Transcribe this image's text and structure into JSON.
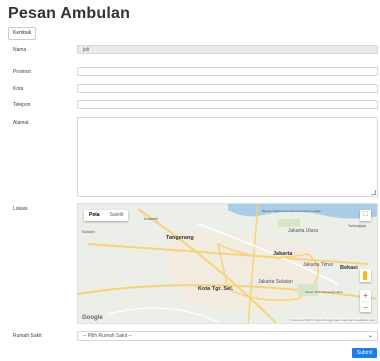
{
  "page": {
    "title": "Pesan Ambulan",
    "back_label": "Kembali"
  },
  "form": {
    "nama": {
      "label": "Nama",
      "value": "joli"
    },
    "provinsi": {
      "label": "Provinsi",
      "value": ""
    },
    "kota": {
      "label": "Kota",
      "value": ""
    },
    "telepon": {
      "label": "Telepon",
      "value": ""
    },
    "alamat": {
      "label": "Alamat",
      "value": ""
    },
    "lokasi": {
      "label": "Lokasi"
    },
    "rumah_sakit": {
      "label": "Rumah Sakit",
      "selected": "-- Pilih Rumah Sakit --"
    },
    "submit_label": "Submit"
  },
  "map": {
    "tabs": [
      "Peta",
      "Satelit"
    ],
    "places": [
      "Tangerang",
      "Jakarta Utara",
      "Jakarta",
      "Jakarta Timur",
      "Jakarta Selatan",
      "Bekasi",
      "Kota Tgr. Sel.",
      "Kosambi",
      "Sukadiri",
      "Tarumajaya",
      "Taman Mini Indonesia Indah",
      "Bandar Udara Internasional Soekarno-Hatta"
    ],
    "branding": "Google",
    "footer": "Data peta ©2021  Syarat Penggunaan  Laporkan kesalahan peta",
    "icons": {
      "fullscreen": "fullscreen-icon",
      "pegman": "pegman-icon",
      "zoom_in": "plus-icon",
      "zoom_out": "minus-icon"
    }
  }
}
